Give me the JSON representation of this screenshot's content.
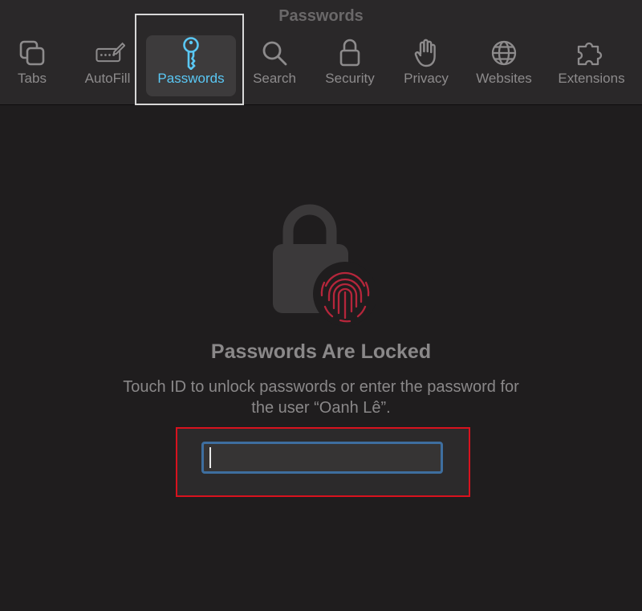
{
  "window": {
    "title": "Passwords"
  },
  "tabs": [
    {
      "label": "Tabs",
      "icon": "tabs-icon"
    },
    {
      "label": "AutoFill",
      "icon": "autofill-icon"
    },
    {
      "label": "Passwords",
      "icon": "key-icon",
      "active": true
    },
    {
      "label": "Search",
      "icon": "search-icon"
    },
    {
      "label": "Security",
      "icon": "lock-icon"
    },
    {
      "label": "Privacy",
      "icon": "hand-icon"
    },
    {
      "label": "Websites",
      "icon": "globe-icon"
    },
    {
      "label": "Extensions",
      "icon": "puzzle-icon"
    }
  ],
  "locked": {
    "title": "Passwords Are Locked",
    "message": "Touch ID to unlock passwords or enter the password for the user “Oanh Lê”.",
    "icons": [
      "padlock-icon",
      "fingerprint-icon"
    ]
  },
  "password_field": {
    "value": "",
    "placeholder": ""
  },
  "colors": {
    "background": "#1f1d1e",
    "toolbar": "#2a2829",
    "accent": "#5ac8f5",
    "highlight": "#d8121e",
    "fingerprint": "#b5263b",
    "field_border": "#3e6e9f"
  }
}
